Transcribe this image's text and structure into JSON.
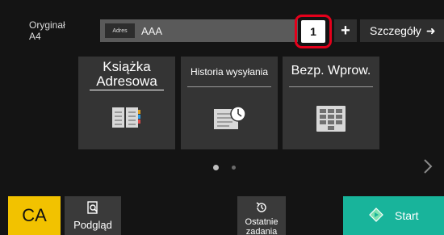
{
  "original": {
    "label": "Oryginał",
    "size": "A4"
  },
  "address": {
    "tag": "Adres",
    "value": "AAA"
  },
  "copies": "1",
  "plus_label": "+",
  "details": {
    "label": "Szczegóły",
    "arrow": "➜"
  },
  "tiles": [
    {
      "label_line1": "Książka",
      "label_line2": "Adresowa",
      "icon": "address-book-icon"
    },
    {
      "label": "Historia wysyłania",
      "icon": "send-history-icon"
    },
    {
      "label": "Bezp. Wprow.",
      "icon": "keypad-icon"
    }
  ],
  "pagination": {
    "current": 1,
    "total": 2
  },
  "bottom_bar": {
    "ca": "CA",
    "preview": "Podgląd",
    "recent_line1": "Ostatnie",
    "recent_line2": "zadania",
    "start": "Start"
  },
  "colors": {
    "background": "#141414",
    "tile": "#343434",
    "ca": "#f2c200",
    "start": "#18b49b",
    "highlight": "#e5001b"
  }
}
